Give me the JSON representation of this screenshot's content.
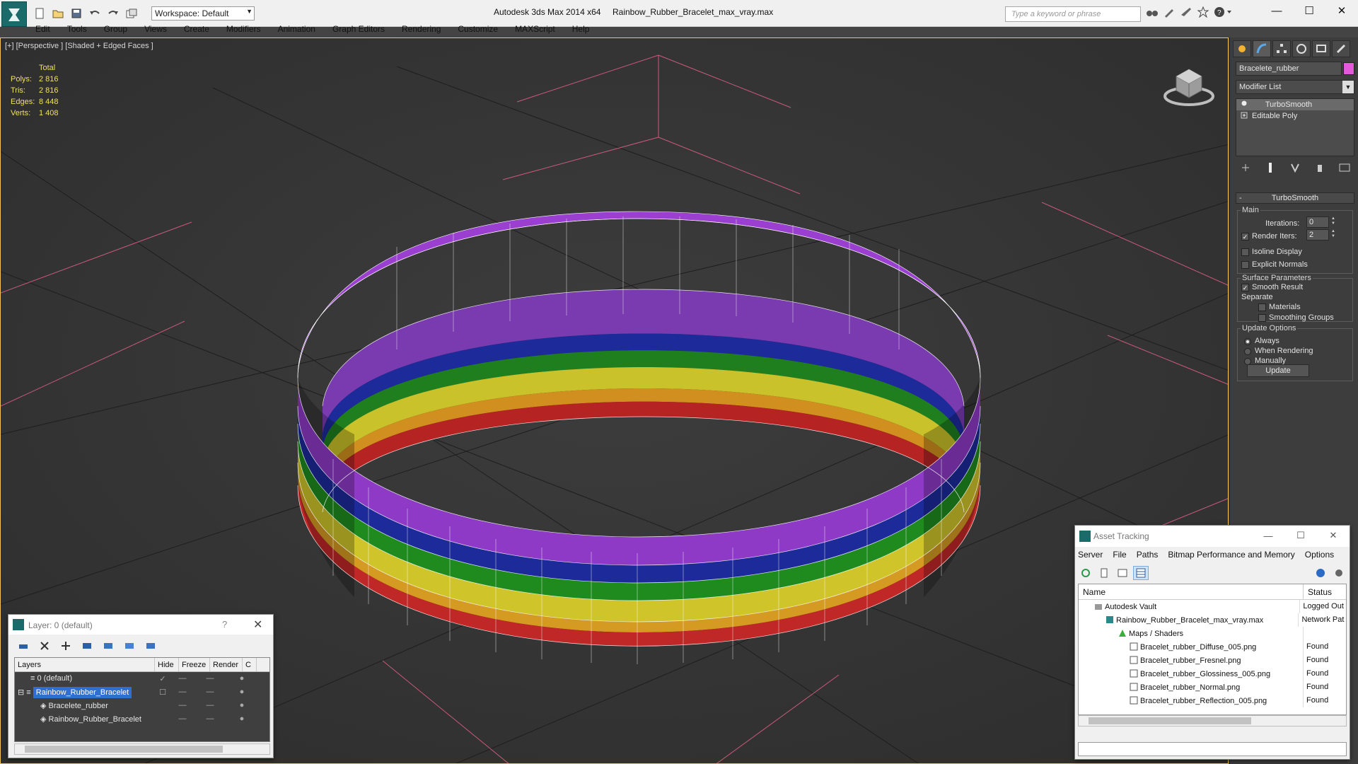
{
  "window": {
    "app_title": "Autodesk 3ds Max  2014 x64",
    "doc_title": "Rainbow_Rubber_Bracelet_max_vray.max",
    "workspace": "Workspace: Default",
    "search_placeholder": "Type a keyword or phrase",
    "minimize": "—",
    "maximize": "☐",
    "close": "✕"
  },
  "menu": [
    "Edit",
    "Tools",
    "Group",
    "Views",
    "Create",
    "Modifiers",
    "Animation",
    "Graph Editors",
    "Rendering",
    "Customize",
    "MAXScript",
    "Help"
  ],
  "viewport": {
    "label": "[+] [Perspective ] [Shaded + Edged Faces ]",
    "stats_header": "Total",
    "stats": [
      {
        "key": "Polys:",
        "value": "2 816"
      },
      {
        "key": "Tris:",
        "value": "2 816"
      },
      {
        "key": "Edges:",
        "value": "8 448"
      },
      {
        "key": "Verts:",
        "value": "1 408"
      }
    ]
  },
  "command_panel": {
    "object_name": "Bracelete_rubber",
    "object_color": "#e259d9",
    "modifier_list": "Modifier List",
    "stack": [
      "TurboSmooth",
      "Editable Poly"
    ],
    "rollout_title": "TurboSmooth",
    "main_group": "Main",
    "iterations_label": "Iterations:",
    "iterations_value": "0",
    "render_iters_label": "Render Iters:",
    "render_iters_value": "2",
    "isoline_display": "Isoline Display",
    "explicit_normals": "Explicit Normals",
    "surface_group": "Surface Parameters",
    "smooth_result": "Smooth Result",
    "separate_label": "Separate",
    "materials": "Materials",
    "smoothing_groups": "Smoothing Groups",
    "update_group": "Update Options",
    "always": "Always",
    "when_rendering": "When Rendering",
    "manually": "Manually",
    "update_button": "Update"
  },
  "asset_tracking": {
    "title": "Asset Tracking",
    "menu": [
      "Server",
      "File",
      "Paths",
      "Bitmap Performance and Memory",
      "Options"
    ],
    "col_name": "Name",
    "col_status": "Status",
    "rows": [
      {
        "name": "Autodesk Vault",
        "status": "Logged Out"
      },
      {
        "name": "Rainbow_Rubber_Bracelet_max_vray.max",
        "status": "Network Pat"
      },
      {
        "name": "Maps / Shaders",
        "status": ""
      },
      {
        "name": "Bracelet_rubber_Diffuse_005.png",
        "status": "Found"
      },
      {
        "name": "Bracelet_rubber_Fresnel.png",
        "status": "Found"
      },
      {
        "name": "Bracelet_rubber_Glossiness_005.png",
        "status": "Found"
      },
      {
        "name": "Bracelet_rubber_Normal.png",
        "status": "Found"
      },
      {
        "name": "Bracelet_rubber_Reflection_005.png",
        "status": "Found"
      }
    ]
  },
  "layer_window": {
    "title": "Layer: 0 (default)",
    "help": "?",
    "close": "✕",
    "col_layers": "Layers",
    "col_hide": "Hide",
    "col_freeze": "Freeze",
    "col_render": "Render",
    "col_c": "C",
    "rows": [
      {
        "name": "0 (default)"
      },
      {
        "name": "Rainbow_Rubber_Bracelet"
      },
      {
        "name": "Bracelete_rubber"
      },
      {
        "name": "Rainbow_Rubber_Bracelet"
      }
    ]
  }
}
